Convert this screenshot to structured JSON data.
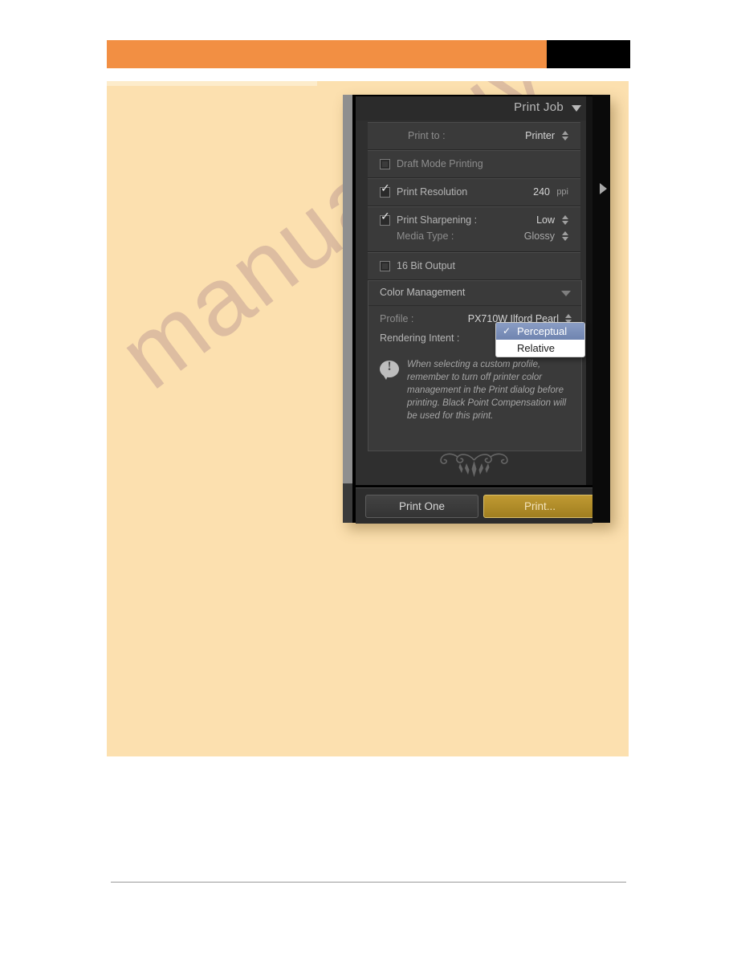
{
  "page": {
    "header_accent_color": "#f28f43",
    "header_block_color": "#000000",
    "body_color": "#fce0af",
    "watermark": "manualshive.com"
  },
  "panel": {
    "title": "Print Job",
    "collapse_icon": "triangle-down-icon",
    "scroll_arrow_icon": "triangle-right-icon",
    "rows": {
      "print_to": {
        "label": "Print to :",
        "value": "Printer"
      },
      "draft_mode": {
        "label": "Draft Mode Printing",
        "checked": false
      },
      "print_resolution": {
        "label": "Print Resolution",
        "value": "240",
        "unit": "ppi",
        "checked": true
      },
      "print_sharpening": {
        "label": "Print Sharpening :",
        "value": "Low",
        "checked": true
      },
      "media_type": {
        "label": "Media Type :",
        "value": "Glossy"
      },
      "sixteen_bit": {
        "label": "16 Bit Output",
        "checked": false
      }
    },
    "color_management": {
      "title": "Color Management",
      "collapse_icon": "triangle-down-icon",
      "profile": {
        "label": "Profile :",
        "value": "PX710W Ilford Pearl"
      },
      "rendering_intent": {
        "label": "Rendering Intent :"
      },
      "note_icon": "exclamation-bubble-icon",
      "note": "When selecting a custom profile, remember to turn off printer color management in the Print dialog before printing. Black Point Compensation will be used for this print."
    },
    "dropdown": {
      "options": [
        {
          "label": "Perceptual",
          "selected": true,
          "check": "✓"
        },
        {
          "label": "Relative",
          "selected": false,
          "check": ""
        }
      ]
    },
    "buttons": {
      "print_one": "Print One",
      "print": "Print...",
      "print_accent_color": "#b8922c"
    }
  }
}
